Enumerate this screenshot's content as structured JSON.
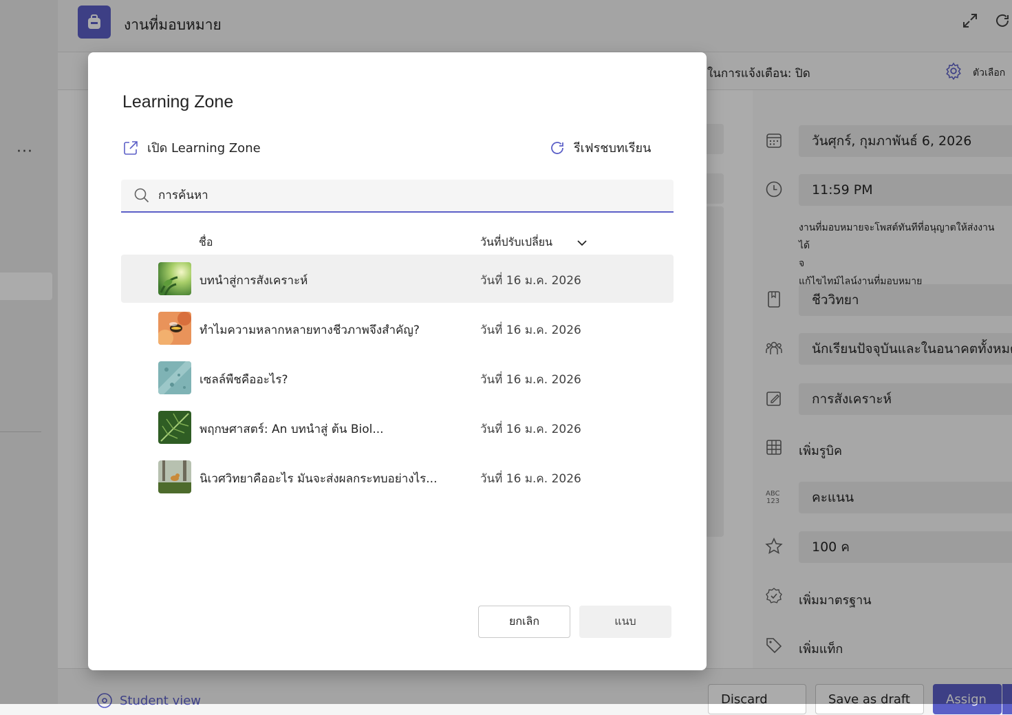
{
  "app": {
    "title": "งานที่มอบหมาย",
    "notification_text": "ในการแจ้งเตือน: ปิด",
    "options_label": "ตัวเลือก",
    "accent": "#5b5fc7"
  },
  "right_panel": {
    "due_date": "วันศุกร์, กุมภาพันธ์ 6, 2026",
    "due_time": "11:59 PM",
    "note_line1": "งานที่มอบหมายจะโพสต์ทันทีที่อนุญาตให้ส่งงานได้",
    "note_line2": "จ",
    "note_line3": "แก้ไขไทม์ไลน์งานที่มอบหมาย",
    "category": "ชีววิทยา",
    "assign_to": "นักเรียนปัจจุบันและในอนาคตทั้งหมด",
    "type": "การสังเคราะห์",
    "add_rubric": "เพิ่มรูบิค",
    "grading": "คะแนน",
    "points": "100 ค",
    "add_standards": "เพิ่มมาตรฐาน",
    "add_tags": "เพิ่มแท็ก"
  },
  "bottom_bar": {
    "student_view": "Student view",
    "discard": "Discard",
    "save_draft": "Save as draft",
    "assign": "Assign"
  },
  "dialog": {
    "title": "Learning Zone",
    "open_link": "เปิด Learning Zone",
    "refresh": "รีเฟรชบทเรียน",
    "search_placeholder": "การค้นหา",
    "col_name": "ชื่อ",
    "col_modified": "วันที่ปรับเปลี่ยน",
    "rows": [
      {
        "name": "บทนำสู่การสังเคราะห์",
        "date": "วันที่ 16 ม.ค. 2026"
      },
      {
        "name": "ทำไมความหลากหลายทางชีวภาพจึงสำคัญ?",
        "date": "วันที่ 16 ม.ค. 2026"
      },
      {
        "name": "เซลล์พืชคืออะไร?",
        "date": "วันที่ 16 ม.ค. 2026"
      },
      {
        "name": "พฤกษศาสตร์: An บทนำสู่ ต้น Biol...",
        "date": "วันที่ 16 ม.ค. 2026"
      },
      {
        "name": "นิเวศวิทยาคืออะไร มันจะส่งผลกระทบอย่างไร...",
        "date": "วันที่ 16 ม.ค. 2026"
      }
    ],
    "cancel": "ยกเลิก",
    "attach": "แนบ"
  }
}
